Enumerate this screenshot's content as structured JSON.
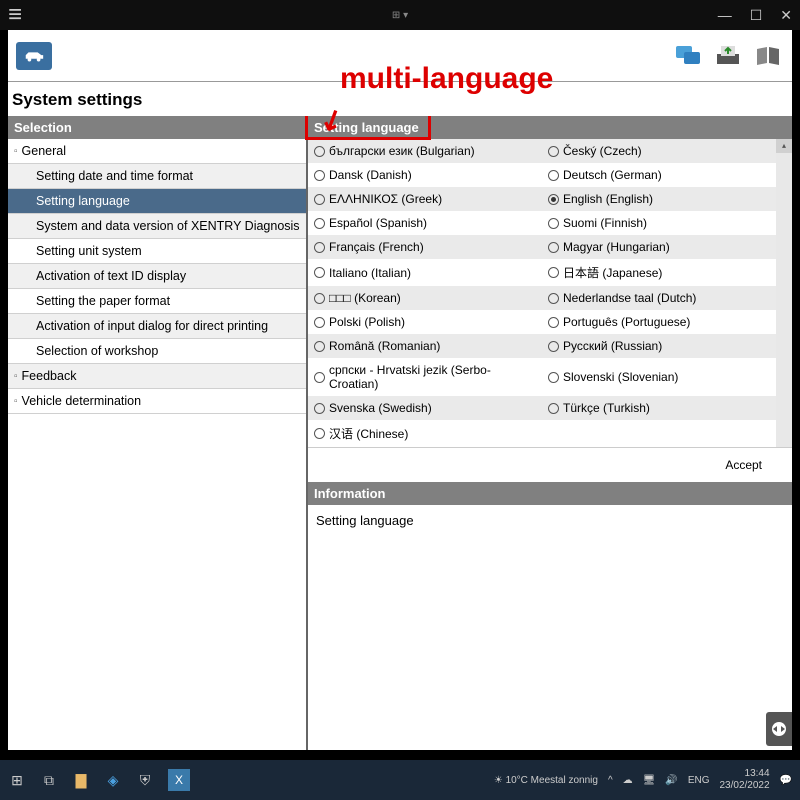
{
  "annotation": {
    "label": "multi-language",
    "arrow": "↙"
  },
  "window": {
    "minimize": "—",
    "maximize": "☐",
    "close": "✕"
  },
  "page_title": "System settings",
  "sidebar": {
    "header": "Selection",
    "groups": [
      {
        "label": "General",
        "children": [
          "Setting date and time format",
          "Setting language",
          "System and data version of XENTRY Diagnosis",
          "Setting unit system",
          "Activation of text ID display",
          "Setting the paper format",
          "Activation of input dialog for direct printing",
          "Selection of workshop"
        ]
      },
      {
        "label": "Feedback",
        "children": []
      },
      {
        "label": "Vehicle determination",
        "children": []
      }
    ],
    "selected": "Setting language"
  },
  "main": {
    "header": "Setting language",
    "languages": [
      {
        "l": "български език (Bulgarian)",
        "r": "Český (Czech)"
      },
      {
        "l": "Dansk (Danish)",
        "r": "Deutsch (German)"
      },
      {
        "l": "ΕΛΛΗΝΙΚΟΣ (Greek)",
        "r": "English (English)",
        "rsel": true
      },
      {
        "l": "Español (Spanish)",
        "r": "Suomi (Finnish)"
      },
      {
        "l": "Français (French)",
        "r": "Magyar (Hungarian)"
      },
      {
        "l": "Italiano (Italian)",
        "r": "日本語 (Japanese)"
      },
      {
        "l": "□□□ (Korean)",
        "r": "Nederlandse taal (Dutch)"
      },
      {
        "l": "Polski (Polish)",
        "r": "Português (Portuguese)"
      },
      {
        "l": "Română (Romanian)",
        "r": "Русский (Russian)"
      },
      {
        "l": "српски - Hrvatski jezik (Serbo-Croatian)",
        "r": "Slovenski (Slovenian)"
      },
      {
        "l": "Svenska (Swedish)",
        "r": "Türkçe (Turkish)"
      },
      {
        "l": "汉语 (Chinese)",
        "r": ""
      }
    ],
    "accept": "Accept"
  },
  "info": {
    "header": "Information",
    "body": "Setting language"
  },
  "taskbar": {
    "weather": "10°C  Meestal zonnig",
    "lang": "ENG",
    "time": "13:44",
    "date": "23/02/2022"
  }
}
